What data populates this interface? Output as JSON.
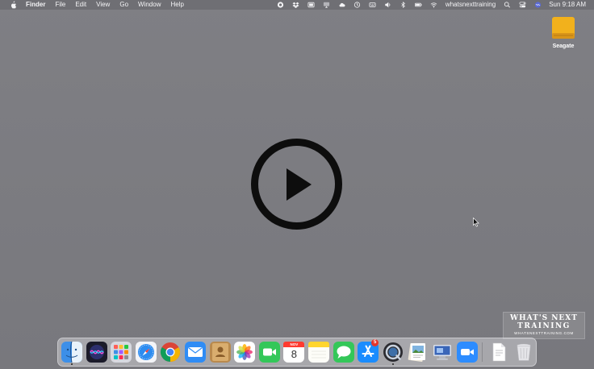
{
  "menubar": {
    "apple_icon": "apple-icon",
    "app_name": "Finder",
    "menus": [
      "File",
      "Edit",
      "View",
      "Go",
      "Window",
      "Help"
    ],
    "status_icons": [
      "screen-record-icon",
      "dropbox-icon",
      "display-icon",
      "cast-icon",
      "cloud-icon",
      "time-machine-icon",
      "keyboard-icon",
      "volume-icon",
      "bluetooth-icon",
      "battery-icon",
      "wifi-icon"
    ],
    "network_name": "whatsnexttraining",
    "trailing_icons": [
      "search-icon",
      "control-center-icon",
      "siri-icon"
    ],
    "clock": "Sun 9:18 AM"
  },
  "desktop": {
    "drive_label": "Seagate",
    "colors": {
      "background": "#7b7b80",
      "drive": "#f2b11c"
    }
  },
  "watermark": {
    "line1": "WHAT'S NEXT",
    "line2": "TRAINING",
    "line3": "WHATSNEXTTRAINING.COM"
  },
  "dock": {
    "apps": [
      {
        "name": "Finder",
        "icon": "finder-icon",
        "running": true
      },
      {
        "name": "Siri",
        "icon": "siri-icon"
      },
      {
        "name": "Launchpad",
        "icon": "launchpad-icon"
      },
      {
        "name": "Safari",
        "icon": "safari-icon"
      },
      {
        "name": "Chrome",
        "icon": "chrome-icon"
      },
      {
        "name": "Mail",
        "icon": "mail-icon"
      },
      {
        "name": "Contacts",
        "icon": "contacts-icon"
      },
      {
        "name": "Photos",
        "icon": "photos-icon"
      },
      {
        "name": "FaceTime",
        "icon": "facetime-icon"
      },
      {
        "name": "Calendar",
        "icon": "calendar-icon",
        "month": "NOV",
        "day": "8"
      },
      {
        "name": "Notes",
        "icon": "notes-icon"
      },
      {
        "name": "Messages",
        "icon": "messages-icon"
      },
      {
        "name": "App Store",
        "icon": "app-store-icon",
        "badge": "5"
      },
      {
        "name": "QuickTime",
        "icon": "quicktime-icon",
        "running": true
      },
      {
        "name": "Preview",
        "icon": "preview-icon"
      },
      {
        "name": "Screen Sharing",
        "icon": "screen-sharing-icon"
      },
      {
        "name": "Zoom",
        "icon": "zoom-icon"
      }
    ],
    "others": [
      {
        "name": "Document",
        "icon": "document-icon"
      },
      {
        "name": "Trash",
        "icon": "trash-icon"
      }
    ]
  }
}
